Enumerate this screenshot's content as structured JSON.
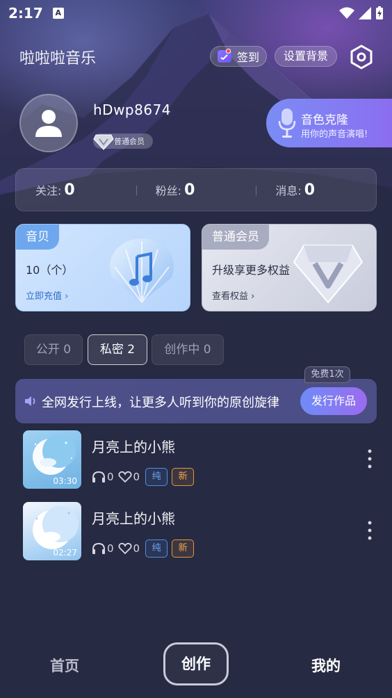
{
  "status_bar": {
    "time": "2:17",
    "a_label": "A"
  },
  "header": {
    "app_title": "啦啦啦音乐",
    "checkin_label": "签到",
    "background_label": "设置背景"
  },
  "profile": {
    "username": "hDwp8674",
    "member_level": "普通会员"
  },
  "voice_clone": {
    "title": "音色克隆",
    "subtitle": "用你的声音演唱!"
  },
  "stats": [
    {
      "label": "关注:",
      "value": "0"
    },
    {
      "label": "粉丝:",
      "value": "0"
    },
    {
      "label": "消息:",
      "value": "0"
    }
  ],
  "cards": {
    "shell": {
      "tag": "音贝",
      "main": "10（个）",
      "link": "立即充值 ›"
    },
    "member": {
      "tag": "普通会员",
      "main": "升级享更多权益",
      "link": "查看权益 ›"
    }
  },
  "tabs": [
    {
      "label": "公开 0"
    },
    {
      "label": "私密 2"
    },
    {
      "label": "创作中 0"
    }
  ],
  "promo": {
    "text": "全网发行上线，让更多人听到你的原创旋律",
    "button": "发行作品",
    "free_chip": "免费1次"
  },
  "songs": [
    {
      "title": "月亮上的小熊",
      "duration": "03:30",
      "plays": "0",
      "likes": "0",
      "tag_pure": "纯",
      "tag_new": "新"
    },
    {
      "title": "月亮上的小熊",
      "duration": "02:27",
      "plays": "0",
      "likes": "0",
      "tag_pure": "纯",
      "tag_new": "新"
    }
  ],
  "bottom_nav": {
    "home": "首页",
    "create": "创作",
    "mine": "我的"
  },
  "colors": {
    "background": "#262a42",
    "accent_purple": "#8b6ef0",
    "accent_blue": "#6e8cf7",
    "tag_blue": "#4f8fe6",
    "tag_orange": "#e29a3d"
  }
}
